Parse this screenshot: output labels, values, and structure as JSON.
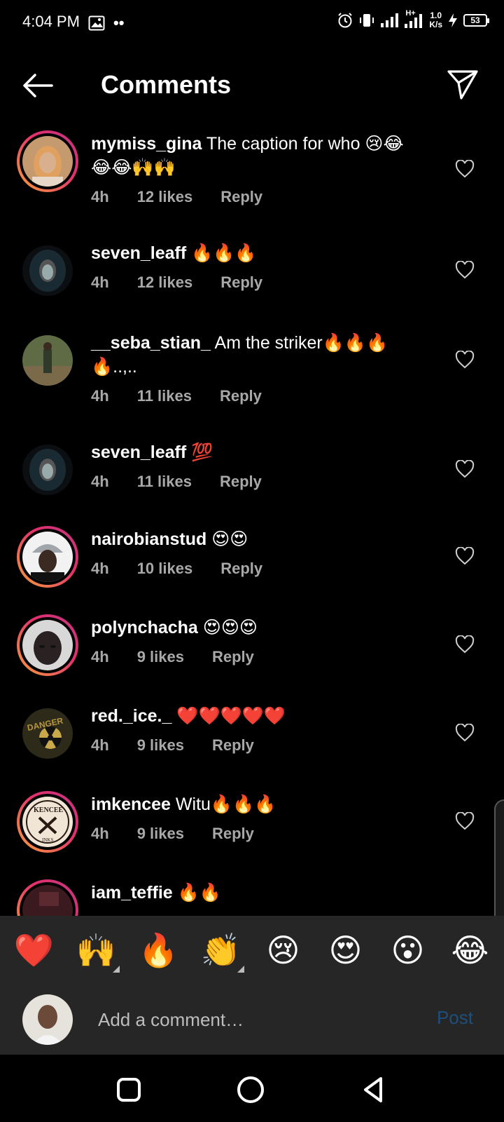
{
  "status_bar": {
    "time": "4:04 PM",
    "dots": "••",
    "speed_value": "1.0",
    "speed_unit": "K/s",
    "net_label": "H+",
    "battery": "53"
  },
  "header": {
    "title": "Comments",
    "back_icon": "arrow-left-icon",
    "share_icon": "paper-plane-icon"
  },
  "comments": [
    {
      "username": "mymiss_gina",
      "text": "The caption for who 😢😂😂😂🙌🙌",
      "time": "4h",
      "likes": "12 likes",
      "reply": "Reply",
      "story_ring": true
    },
    {
      "username": "seven_leaff",
      "text": "🔥🔥🔥",
      "time": "4h",
      "likes": "12 likes",
      "reply": "Reply",
      "story_ring": false
    },
    {
      "username": "__seba_stian_",
      "text": "Am the striker🔥🔥🔥🔥..,..",
      "time": "4h",
      "likes": "11 likes",
      "reply": "Reply",
      "story_ring": false
    },
    {
      "username": "seven_leaff",
      "text": "💯",
      "time": "4h",
      "likes": "11 likes",
      "reply": "Reply",
      "story_ring": false
    },
    {
      "username": "nairobianstud",
      "text": "😍😍",
      "time": "4h",
      "likes": "10 likes",
      "reply": "Reply",
      "story_ring": true
    },
    {
      "username": "polynchacha",
      "text": "😍😍😍",
      "time": "4h",
      "likes": "9 likes",
      "reply": "Reply",
      "story_ring": true
    },
    {
      "username": "red._ice._",
      "text": "❤️❤️❤️❤️❤️",
      "time": "4h",
      "likes": "9 likes",
      "reply": "Reply",
      "story_ring": false,
      "avatar_text": "DANGER"
    },
    {
      "username": "imkencee",
      "text": "Witu🔥🔥🔥",
      "time": "4h",
      "likes": "9 likes",
      "reply": "Reply",
      "story_ring": true,
      "avatar_text": "KENCEE",
      "avatar_subtext": "INKS"
    },
    {
      "username": "iam_teffie",
      "text": "🔥🔥",
      "time": "",
      "likes": "",
      "reply": "",
      "story_ring": true
    }
  ],
  "emoji_bar": {
    "items": [
      "❤️",
      "🙌",
      "🔥",
      "👏",
      "😢",
      "😍",
      "😮",
      "😂"
    ]
  },
  "composer": {
    "placeholder": "Add a comment…",
    "post_label": "Post"
  },
  "nav": {
    "recents_icon": "square-icon",
    "home_icon": "circle-icon",
    "back_icon": "triangle-back-icon"
  },
  "colors": {
    "background": "#000000",
    "panel": "#262626",
    "meta_text": "#a8a8a8",
    "post_disabled": "#1d4f7d"
  }
}
